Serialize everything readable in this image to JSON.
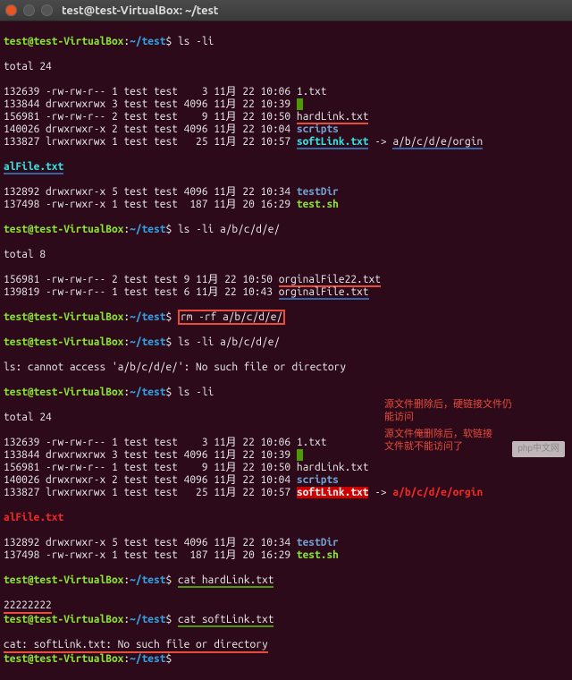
{
  "window": {
    "title": "test@test-VirtualBox: ~/test"
  },
  "prompt": {
    "user": "test@test-VirtualBox",
    "sep": ":",
    "path": "~/test",
    "sym": "$"
  },
  "totals": {
    "t24": "total 24",
    "t8": "total 8"
  },
  "commands": {
    "ls_li": "ls -li",
    "ls_li_path": "ls -li a/b/c/d/e/",
    "rm": "rm -rf a/b/c/d/e/",
    "cat_hard": "cat hardLink.txt",
    "cat_soft": "cat softLink.txt"
  },
  "errors": {
    "no_access": "ls: cannot access 'a/b/c/d/e/': No such file or directory",
    "no_file": "cat: softLink.txt: No such file or directory"
  },
  "output": {
    "cat_hard": "22222222"
  },
  "listing1": [
    {
      "inode": "132639",
      "perm": "-rw-rw-r--",
      "n": "1",
      "ow": "test",
      "gr": "test",
      "sz": "3",
      "mo": "11月",
      "da": "22",
      "tm": "10:06",
      "name": "1.txt",
      "cls": "white"
    },
    {
      "inode": "133844",
      "perm": "drwxrwxrwx",
      "n": "3",
      "ow": "test",
      "gr": "test",
      "sz": "4096",
      "mo": "11月",
      "da": "22",
      "tm": "10:39",
      "name": "a",
      "cls": "hl-green"
    },
    {
      "inode": "156981",
      "perm": "-rw-rw-r--",
      "n": "2",
      "ow": "test",
      "gr": "test",
      "sz": "9",
      "mo": "11月",
      "da": "22",
      "tm": "10:50",
      "name": "hardLink.txt",
      "cls": "white",
      "ul": "ul-red"
    },
    {
      "inode": "140026",
      "perm": "drwxrwxr-x",
      "n": "2",
      "ow": "test",
      "gr": "test",
      "sz": "4096",
      "mo": "11月",
      "da": "22",
      "tm": "10:04",
      "name": "scripts",
      "cls": "blue"
    },
    {
      "inode": "133827",
      "perm": "lrwxrwxrwx",
      "n": "1",
      "ow": "test",
      "gr": "test",
      "sz": "25",
      "mo": "11月",
      "da": "22",
      "tm": "10:57",
      "name": "softLink.txt",
      "cls": "cyan",
      "ul": "ul-blue",
      "arrow": " -> ",
      "target": "a/b/c/d/e/orgin"
    }
  ],
  "listing1_cont": {
    "name": "alFile.txt",
    "cls": "cyan",
    "ul": "ul-blue"
  },
  "listing1_tail": [
    {
      "inode": "132892",
      "perm": "drwxrwxr-x",
      "n": "5",
      "ow": "test",
      "gr": "test",
      "sz": "4096",
      "mo": "11月",
      "da": "22",
      "tm": "10:34",
      "name": "testDir",
      "cls": "blue"
    },
    {
      "inode": "137498",
      "perm": "-rw-rwxr-x",
      "n": "1",
      "ow": "test",
      "gr": "test",
      "sz": "187",
      "mo": "11月",
      "da": "20",
      "tm": "16:29",
      "name": "test.sh",
      "cls": "green"
    }
  ],
  "listing2": [
    {
      "inode": "156981",
      "perm": "-rw-rw-r--",
      "n": "2",
      "ow": "test",
      "gr": "test",
      "sz": "9",
      "mo": "11月",
      "da": "22",
      "tm": "10:50",
      "name": "orginalFile22.txt",
      "cls": "white",
      "ul": "ul-red"
    },
    {
      "inode": "139819",
      "perm": "-rw-rw-r--",
      "n": "1",
      "ow": "test",
      "gr": "test",
      "sz": "6",
      "mo": "11月",
      "da": "22",
      "tm": "10:43",
      "name": "orginalFile.txt",
      "cls": "white",
      "ul": "ul-blue"
    }
  ],
  "listing3": [
    {
      "inode": "132639",
      "perm": "-rw-rw-r--",
      "n": "1",
      "ow": "test",
      "gr": "test",
      "sz": "3",
      "mo": "11月",
      "da": "22",
      "tm": "10:06",
      "name": "1.txt",
      "cls": "white"
    },
    {
      "inode": "133844",
      "perm": "drwxrwxrwx",
      "n": "3",
      "ow": "test",
      "gr": "test",
      "sz": "4096",
      "mo": "11月",
      "da": "22",
      "tm": "10:39",
      "name": "a",
      "cls": "hl-green"
    },
    {
      "inode": "156981",
      "perm": "-rw-rw-r--",
      "n": "1",
      "ow": "test",
      "gr": "test",
      "sz": "9",
      "mo": "11月",
      "da": "22",
      "tm": "10:50",
      "name": "hardLink.txt",
      "cls": "white"
    },
    {
      "inode": "140026",
      "perm": "drwxrwxr-x",
      "n": "2",
      "ow": "test",
      "gr": "test",
      "sz": "4096",
      "mo": "11月",
      "da": "22",
      "tm": "10:04",
      "name": "scripts",
      "cls": "blue"
    },
    {
      "inode": "133827",
      "perm": "lrwxrwxrwx",
      "n": "1",
      "ow": "test",
      "gr": "test",
      "sz": "25",
      "mo": "11月",
      "da": "22",
      "tm": "10:57",
      "name": "softLink.txt",
      "cls": "hl-red",
      "arrow": " -> ",
      "target": "a/b/c/d/e/orgin",
      "tcls": "redbold"
    }
  ],
  "listing3_cont": {
    "name": "alFile.txt",
    "cls": "redbold"
  },
  "listing3_tail": [
    {
      "inode": "132892",
      "perm": "drwxrwxr-x",
      "n": "5",
      "ow": "test",
      "gr": "test",
      "sz": "4096",
      "mo": "11月",
      "da": "22",
      "tm": "10:34",
      "name": "testDir",
      "cls": "blue"
    },
    {
      "inode": "137498",
      "perm": "-rw-rwxr-x",
      "n": "1",
      "ow": "test",
      "gr": "test",
      "sz": "187",
      "mo": "11月",
      "da": "20",
      "tm": "16:29",
      "name": "test.sh",
      "cls": "green"
    }
  ],
  "annotations": {
    "hard1": "源文件删除后，硬链接文件仍",
    "hard2": "能访问",
    "soft1": "源文件俺删除后，软链接",
    "soft2": "文件就不能访问了"
  },
  "watermark": "php中文网"
}
